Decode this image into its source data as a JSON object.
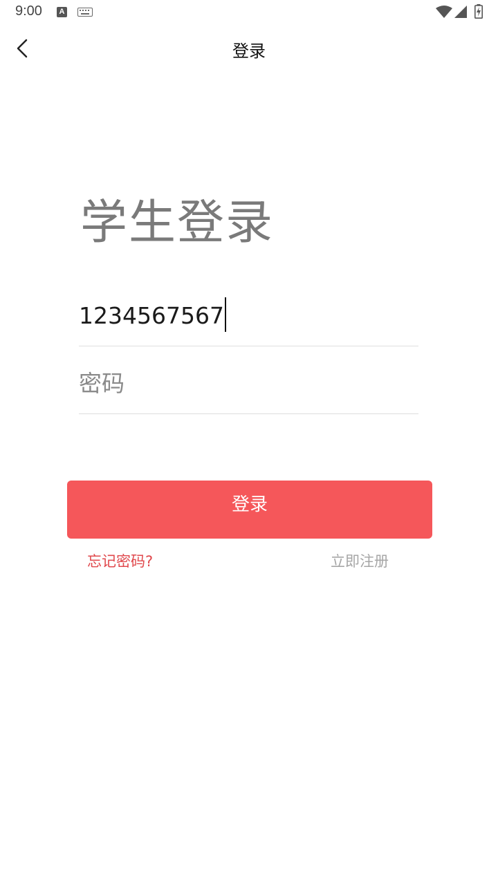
{
  "status_bar": {
    "time": "9:00",
    "a_icon_label": "A",
    "icons": [
      "text-a-icon",
      "keyboard-icon",
      "wifi-icon",
      "cell-signal-icon",
      "battery-charging-icon"
    ]
  },
  "app_bar": {
    "title": "登录",
    "back_icon": "chevron-left-icon"
  },
  "headline": "学生登录",
  "form": {
    "phone_value": "1234567567",
    "password_placeholder": "密码"
  },
  "login_button_label": "登录",
  "forgot_password_label": "忘记密码?",
  "register_label": "立即注册",
  "colors": {
    "accent": "#f5575a",
    "forgot_link": "#e0484c",
    "register_link": "#a6a6a6",
    "headline": "#7a7a7a"
  }
}
